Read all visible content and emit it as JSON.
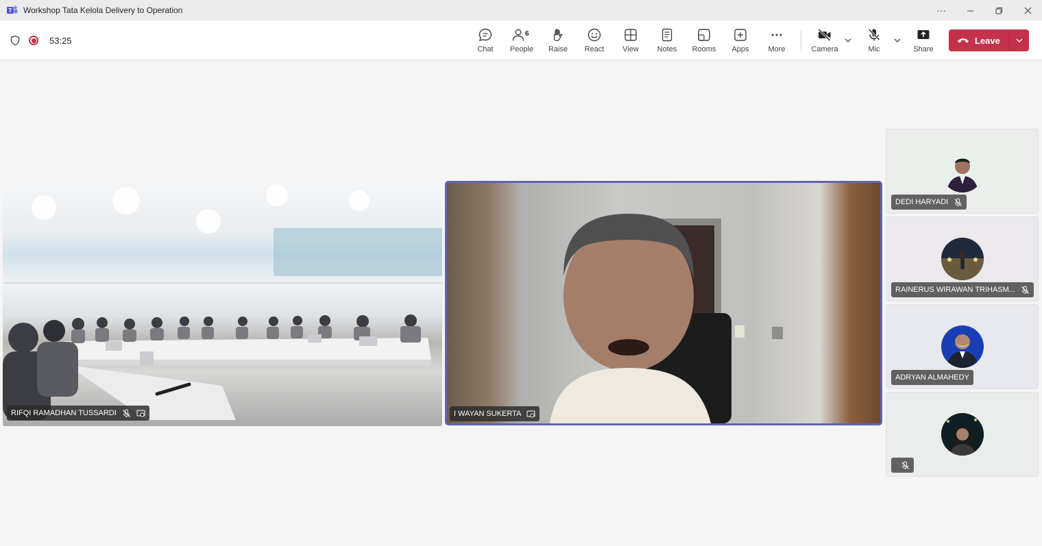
{
  "window": {
    "title": "Workshop Tata Kelola Delivery to Operation",
    "controls": {
      "more": "···"
    }
  },
  "meeting": {
    "timer": "53:25",
    "people_count": "6"
  },
  "toolbar": {
    "chat": "Chat",
    "people": "People",
    "raise": "Raise",
    "react": "React",
    "view": "View",
    "notes": "Notes",
    "rooms": "Rooms",
    "apps": "Apps",
    "more": "More",
    "camera": "Camera",
    "mic": "Mic",
    "share": "Share",
    "leave": "Leave"
  },
  "stage": {
    "tiles": [
      {
        "name": "RIFQI RAMADHAN TUSSARDI"
      },
      {
        "name": "I WAYAN SUKERTA"
      }
    ]
  },
  "roster": {
    "participants": [
      {
        "name": "DEDI HARYADI"
      },
      {
        "name": "RAINERUS WIRAWAN TRIHASM..."
      },
      {
        "name": "ADRYAN ALMAHEDY"
      },
      {
        "name": ""
      }
    ]
  },
  "colors": {
    "brand": "#6264a7",
    "leave": "#c4314b",
    "recording": "#c4314b"
  }
}
